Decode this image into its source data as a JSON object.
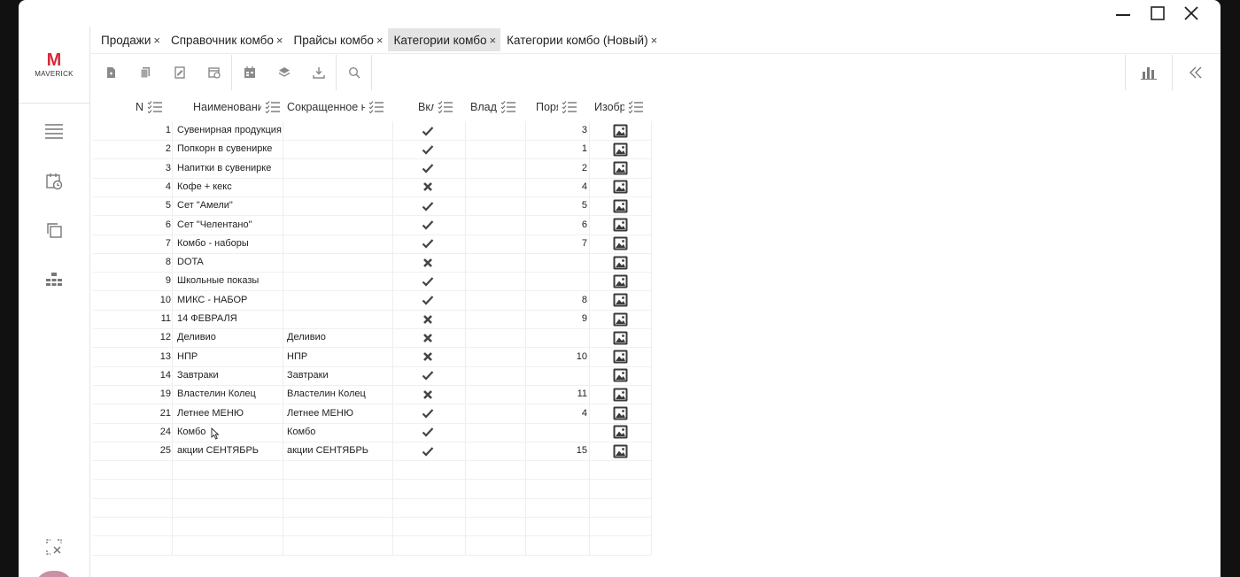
{
  "window_controls": {
    "minimize": "minimize-icon",
    "maximize": "maximize-icon",
    "close": "close-icon"
  },
  "logo": {
    "text": "MAVERICK",
    "mark": "M",
    "color": "#d9283a"
  },
  "tabs": [
    {
      "label": "Продажи",
      "active": false
    },
    {
      "label": "Справочник комбо",
      "active": false
    },
    {
      "label": "Прайсы комбо",
      "active": false
    },
    {
      "label": "Категории комбо",
      "active": true
    },
    {
      "label": "Категории комбо (Новый)",
      "active": false
    }
  ],
  "tab_close_glyph": "×",
  "toolbar": [
    "new-document-icon",
    "copy-document-icon",
    "edit-document-icon",
    "settings-document-icon",
    "calendar-icon",
    "layers-icon",
    "download-icon",
    "search-icon"
  ],
  "toolbar_right": [
    "bar-chart-icon",
    "collapse-panel-icon"
  ],
  "sidebar": [
    "menu-icon",
    "calendar-clock-icon",
    "copy-icon",
    "hierarchy-icon",
    "selection-close-icon"
  ],
  "columns": [
    "N",
    "Наименовани",
    "Сокращенное на",
    "Вкл",
    "Влад",
    "Поря",
    "Изобр"
  ],
  "rows": [
    {
      "n": "1",
      "name": "Сувенирная продукция",
      "short": "",
      "enabled": true,
      "order": "3"
    },
    {
      "n": "2",
      "name": "Попкорн в сувенирке",
      "short": "",
      "enabled": true,
      "order": "1"
    },
    {
      "n": "3",
      "name": "Напитки в сувенирке",
      "short": "",
      "enabled": true,
      "order": "2"
    },
    {
      "n": "4",
      "name": "Кофе +  кекс",
      "short": "",
      "enabled": false,
      "order": "4"
    },
    {
      "n": "5",
      "name": "Сет \"Амели\"",
      "short": "",
      "enabled": true,
      "order": "5"
    },
    {
      "n": "6",
      "name": "Сет \"Челентано\"",
      "short": "",
      "enabled": true,
      "order": "6"
    },
    {
      "n": "7",
      "name": "Комбо - наборы",
      "short": "",
      "enabled": true,
      "order": "7"
    },
    {
      "n": "8",
      "name": "DOTA",
      "short": "",
      "enabled": false,
      "order": ""
    },
    {
      "n": "9",
      "name": "Школьные показы",
      "short": "",
      "enabled": true,
      "order": ""
    },
    {
      "n": "10",
      "name": "МИКС - НАБОР",
      "short": "",
      "enabled": true,
      "order": "8"
    },
    {
      "n": "11",
      "name": "14 ФЕВРАЛЯ",
      "short": "",
      "enabled": false,
      "order": "9"
    },
    {
      "n": "12",
      "name": "Деливио",
      "short": "Деливио",
      "enabled": false,
      "order": ""
    },
    {
      "n": "13",
      "name": "НПР",
      "short": "НПР",
      "enabled": false,
      "order": "10"
    },
    {
      "n": "14",
      "name": "Завтраки",
      "short": "Завтраки",
      "enabled": true,
      "order": ""
    },
    {
      "n": "19",
      "name": "Властелин Колец",
      "short": "Властелин Колец",
      "enabled": false,
      "order": "11"
    },
    {
      "n": "21",
      "name": "Летнее МЕНЮ",
      "short": "Летнее МЕНЮ",
      "enabled": true,
      "order": "4"
    },
    {
      "n": "24",
      "name": "Комбо",
      "short": "Комбо",
      "enabled": true,
      "order": ""
    },
    {
      "n": "25",
      "name": "акции СЕНТЯБРЬ",
      "short": "акции СЕНТЯБРЬ",
      "enabled": true,
      "order": "15"
    }
  ],
  "empty_rows": 5,
  "colors": {
    "accent": "#d9283a",
    "icon": "#8a8a8a",
    "active_tab": "#e4e4e4"
  }
}
